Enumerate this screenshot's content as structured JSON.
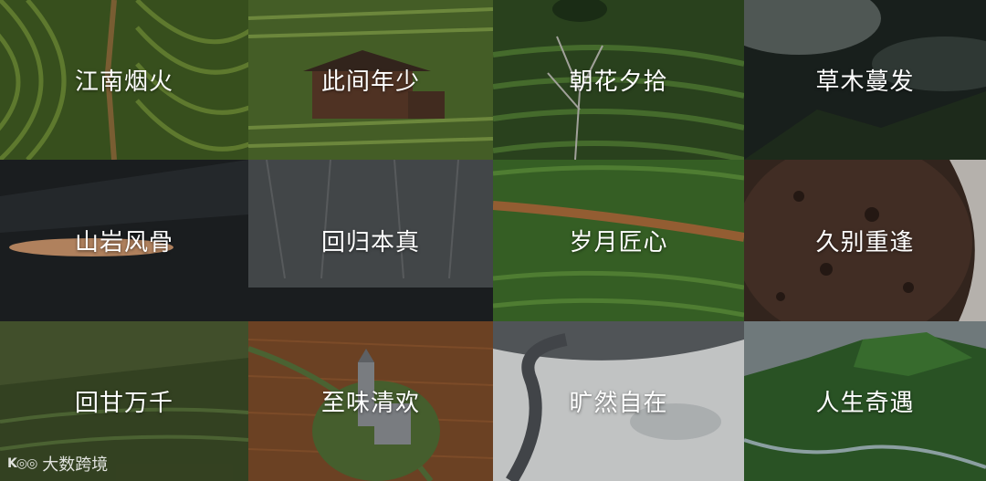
{
  "tiles": [
    {
      "label": "江南烟火"
    },
    {
      "label": "此间年少"
    },
    {
      "label": "朝花夕拾"
    },
    {
      "label": "草木蔓发"
    },
    {
      "label": "山岩风骨"
    },
    {
      "label": "回归本真"
    },
    {
      "label": "岁月匠心"
    },
    {
      "label": "久别重逢"
    },
    {
      "label": "回甘万千"
    },
    {
      "label": "至味清欢"
    },
    {
      "label": "旷然自在"
    },
    {
      "label": "人生奇遇"
    }
  ],
  "watermark": {
    "logo": "K◎◎",
    "text": "大数跨境"
  }
}
